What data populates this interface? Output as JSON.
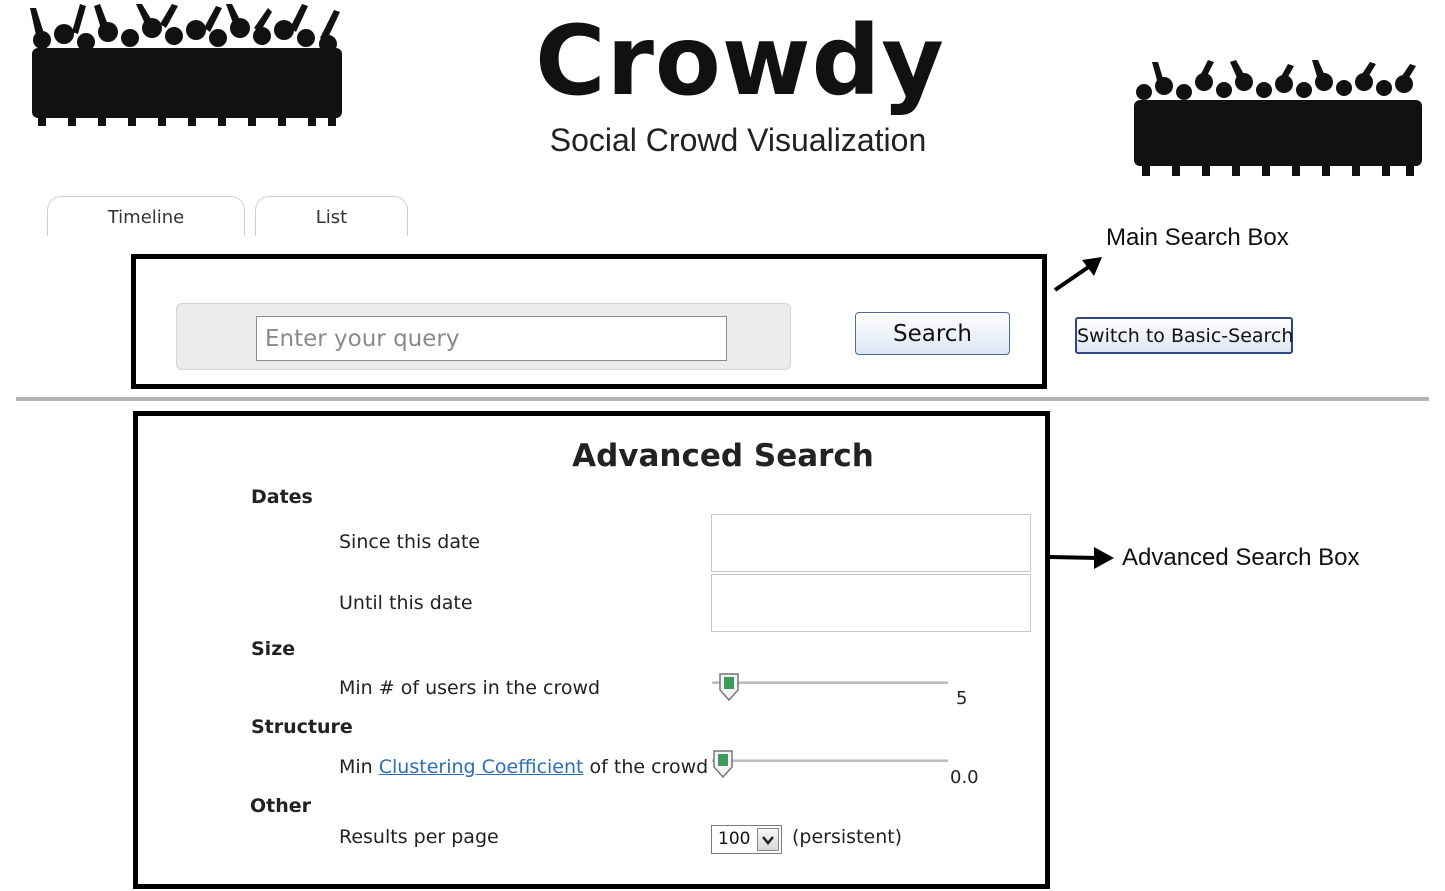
{
  "header": {
    "logo": "Crowdy",
    "subtitle": "Social Crowd Visualization"
  },
  "tabs": [
    {
      "label": "Timeline"
    },
    {
      "label": "List"
    }
  ],
  "main_search": {
    "placeholder": "Enter your query",
    "value": "",
    "search_label": "Search",
    "switch_label": "Switch to Basic-Search"
  },
  "annotations": {
    "main": "Main Search Box",
    "advanced": "Advanced Search Box"
  },
  "advanced": {
    "title": "Advanced Search",
    "dates": {
      "heading": "Dates",
      "since_label": "Since this date",
      "until_label": "Until this date",
      "since_value": "",
      "until_value": ""
    },
    "size": {
      "heading": "Size",
      "label": "Min # of users in the crowd",
      "value": "5",
      "slider_fraction": 0.03
    },
    "structure": {
      "heading": "Structure",
      "label_prefix": "Min",
      "link": "Clustering Coefficient",
      "label_suffix": "of the crowd",
      "value": "0.0",
      "slider_fraction": 0.0
    },
    "other": {
      "heading": "Other",
      "label": "Results per page",
      "select_value": "100",
      "note": "(persistent)"
    }
  },
  "colors": {
    "link": "#2a6fb8",
    "box_border": "#000000",
    "slider_thumb": "#3d9a5a"
  }
}
